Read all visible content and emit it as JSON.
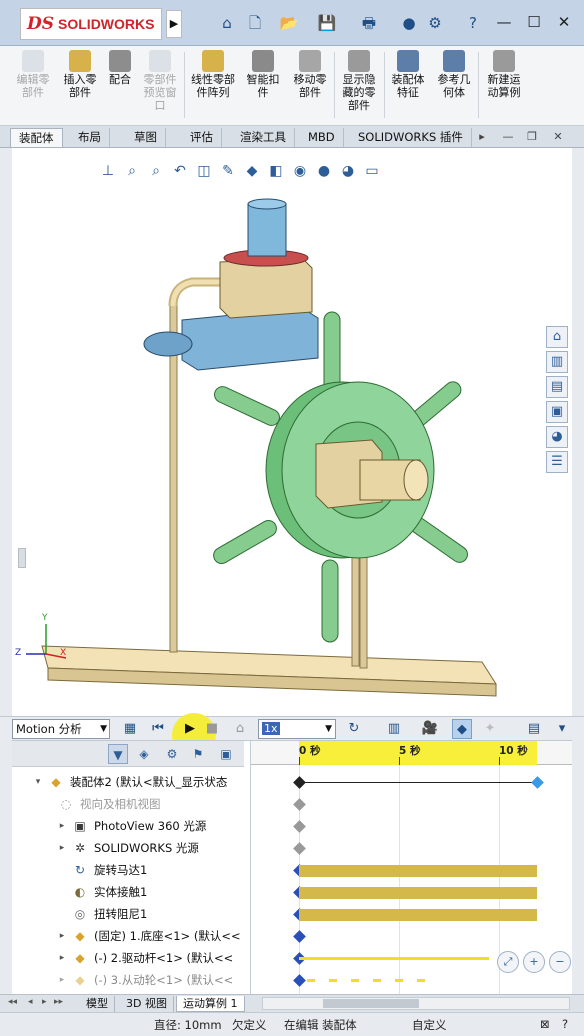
{
  "titlebar": {
    "brand_ds": "DS",
    "brand_name": "SOLIDWORKS",
    "quick_access": [
      "home-icon",
      "new-document-icon",
      "open-icon",
      "save-icon",
      "print-icon",
      "rebuild-icon",
      "options-icon",
      "help-icon"
    ],
    "window_controls": [
      "minimize-icon",
      "restore-icon",
      "close-icon"
    ]
  },
  "ribbon": {
    "buttons": [
      {
        "label": "编辑零\n部件",
        "enabled": false
      },
      {
        "label": "插入零\n部件",
        "enabled": true
      },
      {
        "label": "配合",
        "enabled": true
      },
      {
        "label": "零部件\n预览窗\n口",
        "enabled": false
      },
      {
        "label": "线性零部\n件阵列",
        "enabled": true
      },
      {
        "label": "智能扣\n件",
        "enabled": true
      },
      {
        "label": "移动零\n部件",
        "enabled": true
      },
      {
        "label": "显示隐\n藏的零\n部件",
        "enabled": true
      },
      {
        "label": "装配体\n特征",
        "enabled": true
      },
      {
        "label": "参考几\n何体",
        "enabled": true
      },
      {
        "label": "新建运\n动算例",
        "enabled": true
      }
    ]
  },
  "tabs": [
    {
      "label": "装配体",
      "active": true
    },
    {
      "label": "布局",
      "active": false
    },
    {
      "label": "草图",
      "active": false
    },
    {
      "label": "评估",
      "active": false
    },
    {
      "label": "渲染工具",
      "active": false
    },
    {
      "label": "MBD",
      "active": false
    },
    {
      "label": "SOLIDWORKS 插件",
      "active": false
    }
  ],
  "graphics": {
    "triad": {
      "x_label": "X",
      "y_label": "Y",
      "z_label": "Z"
    },
    "model_colors": {
      "base": "#f0dca8",
      "rod": "#d9c79a",
      "wheel": "#8fd19a",
      "hex_nut": "#e0cfa0",
      "shaft": "#7eb6d8",
      "housing": "#7eb6d8"
    }
  },
  "motion": {
    "study_type": "Motion 分析",
    "playback_speed": "1x"
  },
  "timeline": {
    "ticks": [
      {
        "label": "0 秒",
        "seconds": 0
      },
      {
        "label": "5 秒",
        "seconds": 5
      },
      {
        "label": "10 秒",
        "seconds": 10
      }
    ],
    "end_time_seconds": 11.5
  },
  "tree": {
    "items": [
      {
        "label": "装配体2 (默认<默认_显示状态",
        "icon": "assembly-icon",
        "expandable": true,
        "expanded": true,
        "dim": false
      },
      {
        "label": "视向及相机视图",
        "icon": "camera-icon",
        "expandable": false,
        "dim": true
      },
      {
        "label": "PhotoView 360 光源",
        "icon": "photoview-icon",
        "expandable": true,
        "dim": false
      },
      {
        "label": "SOLIDWORKS 光源",
        "icon": "light-icon",
        "expandable": true,
        "dim": false
      },
      {
        "label": "旋转马达1",
        "icon": "motor-icon",
        "expandable": false,
        "dim": false
      },
      {
        "label": "实体接触1",
        "icon": "contact-icon",
        "expandable": false,
        "dim": false
      },
      {
        "label": "扭转阻尼1",
        "icon": "damper-icon",
        "expandable": false,
        "dim": false
      },
      {
        "label": "(固定) 1.底座<1> (默认<<",
        "icon": "part-icon",
        "expandable": true,
        "dim": false
      },
      {
        "label": "(-) 2.驱动杆<1> (默认<<",
        "icon": "part-icon",
        "expandable": true,
        "dim": false
      },
      {
        "label": "(-) 3.从动轮<1> (默认<<",
        "icon": "part-icon",
        "expandable": true,
        "dim": false
      }
    ]
  },
  "bottom_tabs": [
    {
      "label": "模型",
      "active": false
    },
    {
      "label": "3D 视图",
      "active": false
    },
    {
      "label": "运动算例 1",
      "active": true
    }
  ],
  "status": {
    "dimension": "直径: 10mm",
    "constraint": "欠定义",
    "mode": "在编辑 装配体",
    "units": "自定义"
  }
}
